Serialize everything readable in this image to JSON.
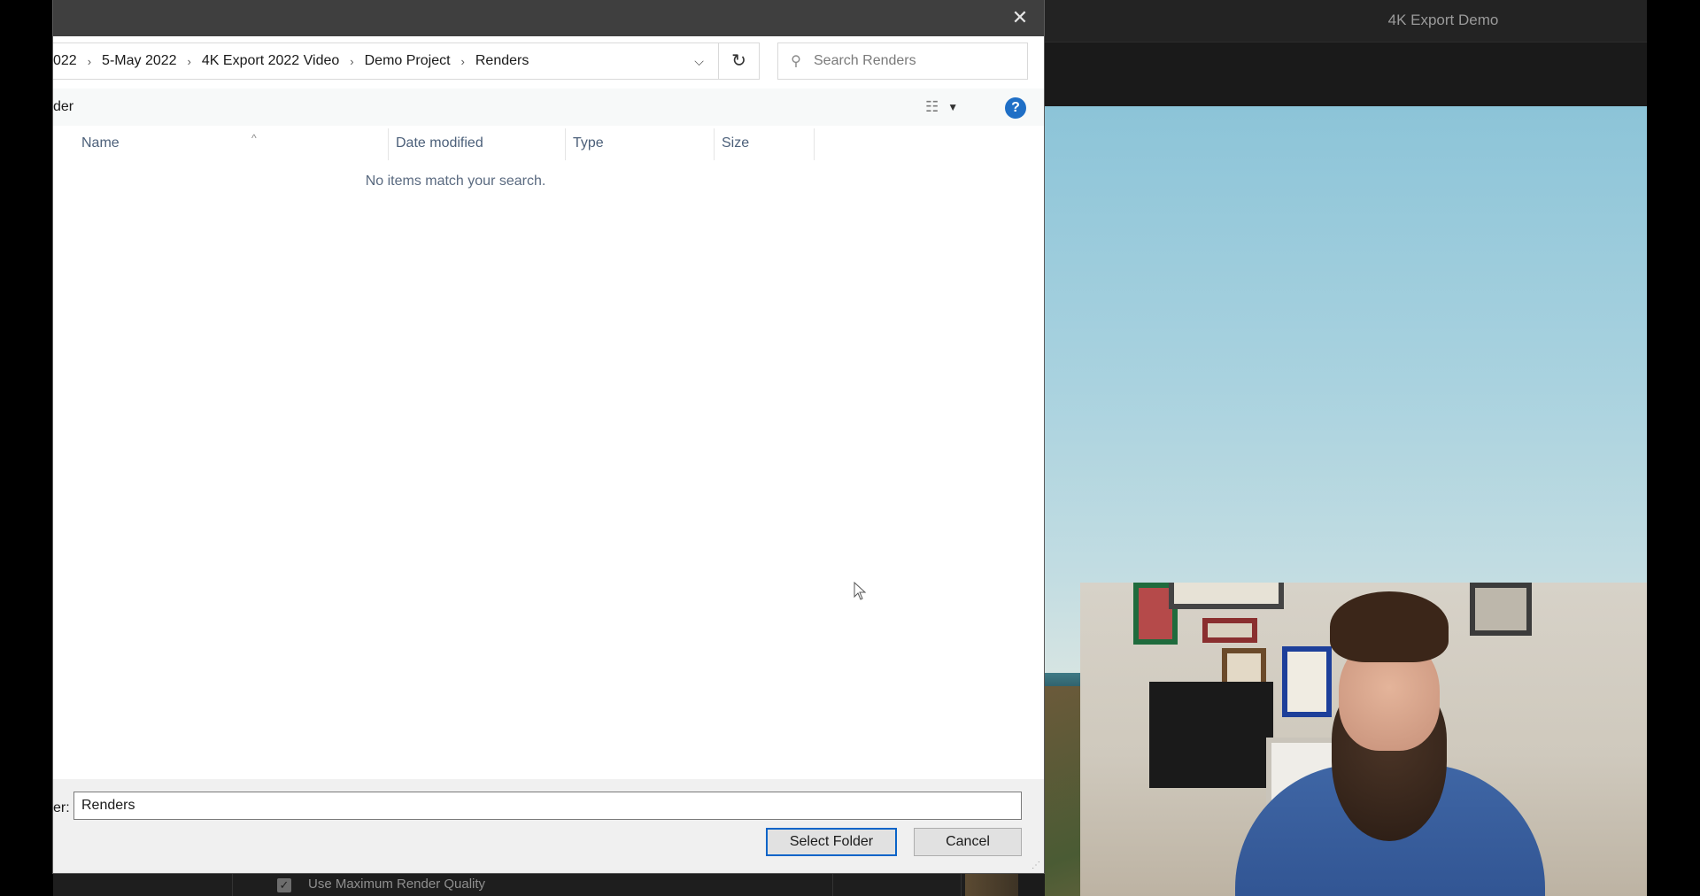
{
  "background_app": {
    "title": "4K Export Demo",
    "render_quality_label": "Use Maximum Render Quality",
    "render_quality_checked": true
  },
  "dialog": {
    "breadcrumb": [
      "022",
      "5-May 2022",
      "4K Export 2022 Video",
      "Demo Project",
      "Renders"
    ],
    "search_placeholder": "Search Renders",
    "command_partial": "der",
    "columns": [
      "Name",
      "Date modified",
      "Type",
      "Size"
    ],
    "empty_message": "No items match your search.",
    "folder_label": "er:",
    "folder_value": "Renders",
    "select_button": "Select Folder",
    "cancel_button": "Cancel",
    "help_label": "?"
  },
  "colors": {
    "accent": "#0a64c8",
    "help": "#1f6fc6",
    "titlebar": "#3f3f3f"
  },
  "icons": {
    "close": "close-icon",
    "chevron_down": "chevron-down-icon",
    "refresh": "refresh-icon",
    "search": "search-icon",
    "view": "details-view-icon",
    "sort": "sort-up-icon"
  }
}
